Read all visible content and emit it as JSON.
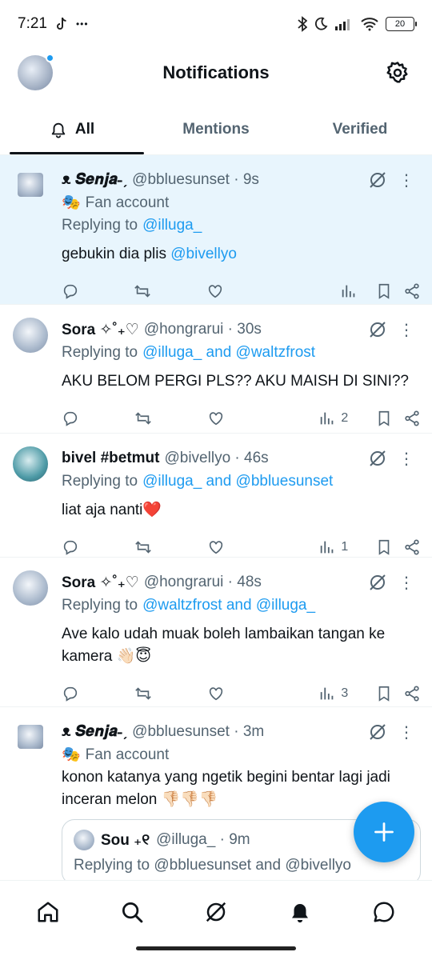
{
  "status_bar": {
    "time": "7:21",
    "extra": "•••",
    "battery": "20"
  },
  "header": {
    "title": "Notifications"
  },
  "tabs": [
    {
      "label": "All"
    },
    {
      "label": "Mentions"
    },
    {
      "label": "Verified"
    }
  ],
  "tweets": [
    {
      "name": "ᴥ 𝑺𝒆𝒏𝒋𝒂˗ˏ",
      "handle": "@bbluesunset · 9s",
      "label": "Fan account",
      "reply_prefix": "Replying to",
      "reply_to": "@illuga_",
      "text_main": "gebukin dia plis ",
      "text_link": "@bivellyo",
      "views": ""
    },
    {
      "name": "Sora ✧˚₊♡",
      "handle": "@hongrarui · 30s",
      "reply_prefix": "Replying to",
      "reply_to": "@illuga_ and @waltzfrost",
      "text_main": "AKU BELOM PERGI PLS?? AKU MAISH DI SINI??",
      "views": "2"
    },
    {
      "name": "bivel #betmut",
      "handle": "@bivellyo · 46s",
      "reply_prefix": "Replying to",
      "reply_to": "@illuga_ and @bbluesunset",
      "text_main": "liat aja nanti❤️",
      "views": "1"
    },
    {
      "name": "Sora ✧˚₊♡",
      "handle": "@hongrarui · 48s",
      "reply_prefix": "Replying to",
      "reply_to": "@waltzfrost and @illuga_",
      "text_main": "Ave kalo udah muak boleh lambaikan tangan ke kamera 👋🏻😇",
      "views": "3"
    },
    {
      "name": "ᴥ 𝑺𝒆𝒏𝒋𝒂˗ˏ",
      "handle": "@bbluesunset · 3m",
      "label": "Fan account",
      "text_main": "konon katanya yang ngetik begini bentar lagi jadi inceran melon 👎🏻👎🏻👎🏻",
      "quote": {
        "name": "Sou ₊୧",
        "handle": "@illuga_ · 9m",
        "reply": "Replying to @bbluesunset and @bivellyo"
      }
    }
  ],
  "colors": {
    "accent": "#1d9bf0",
    "highlight_bg": "#e8f5fd",
    "muted": "#536471"
  },
  "icons": [
    "settings-icon",
    "bell-icon",
    "grok-icon",
    "more-icon",
    "reply-icon",
    "retweet-icon",
    "like-icon",
    "views-icon",
    "bookmark-icon",
    "share-icon",
    "compose-icon",
    "home-icon",
    "search-icon",
    "messages-icon",
    "mask-icon"
  ]
}
